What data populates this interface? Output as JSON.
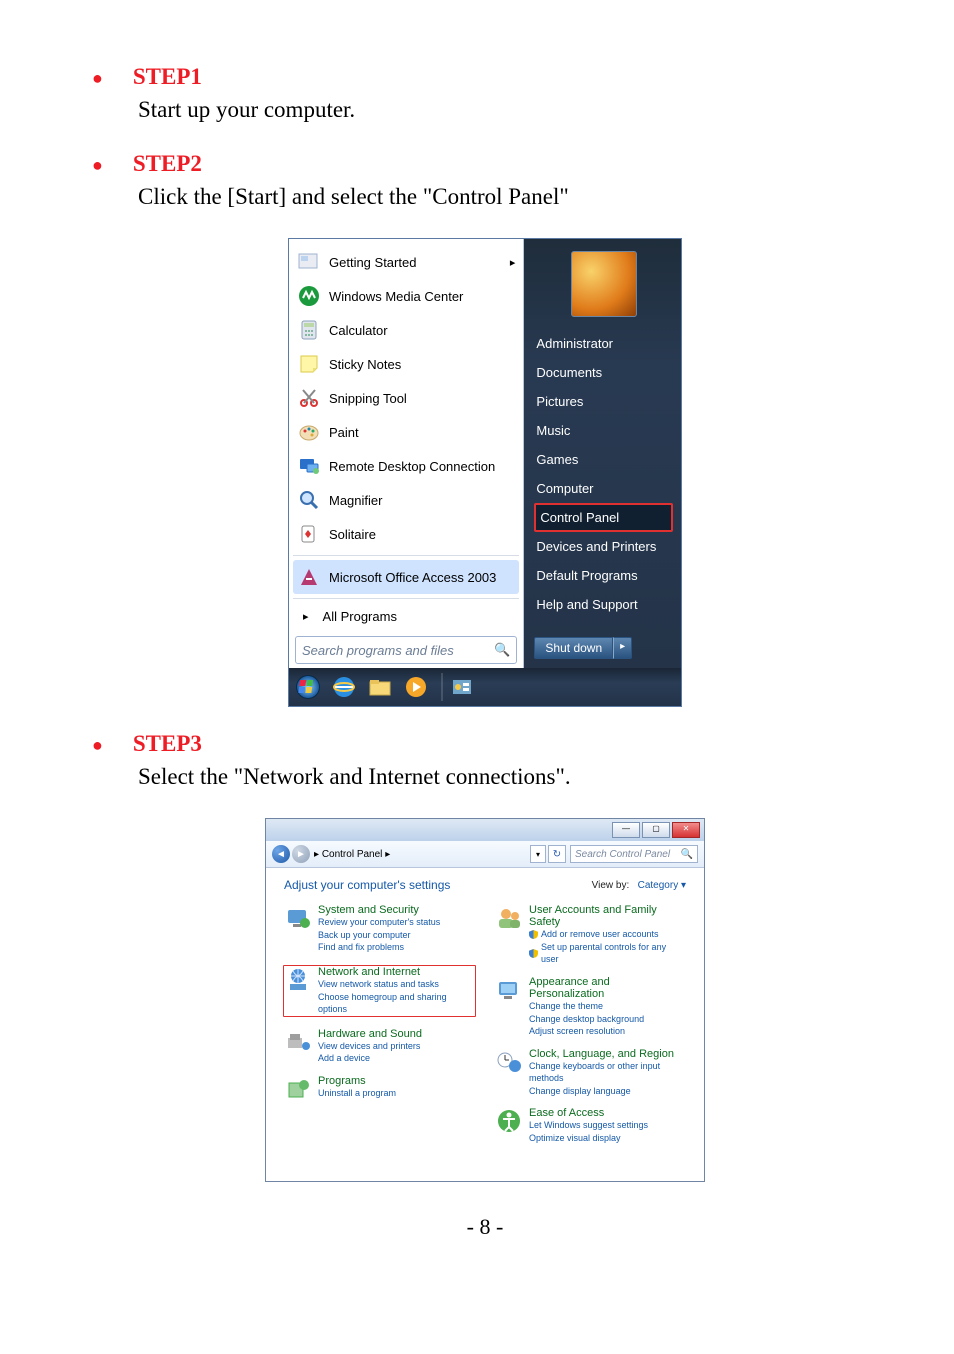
{
  "steps": {
    "s1": {
      "title": "STEP1",
      "desc": "Start up your computer."
    },
    "s2": {
      "title": "STEP2",
      "desc": "Click the [Start] and select the \"Control Panel\""
    },
    "s3": {
      "title": "STEP3",
      "desc": "Select the \"Network and Internet connections\"."
    }
  },
  "startmenu": {
    "left_items": [
      "Getting Started",
      "Windows Media Center",
      "Calculator",
      "Sticky Notes",
      "Snipping Tool",
      "Paint",
      "Remote Desktop Connection",
      "Magnifier",
      "Solitaire",
      "Microsoft Office Access 2003"
    ],
    "all_programs": "All Programs",
    "search_placeholder": "Search programs and files",
    "user_name": "Administrator",
    "right_items": [
      "Documents",
      "Pictures",
      "Music",
      "Games",
      "Computer",
      "Control Panel",
      "Devices and Printers",
      "Default Programs",
      "Help and Support"
    ],
    "shutdown": "Shut down"
  },
  "control_panel": {
    "breadcrumb": "Control Panel",
    "search_placeholder": "Search Control Panel",
    "adjust_heading": "Adjust your computer's settings",
    "view_by_label": "View by:",
    "view_by_value": "Category ▾",
    "left": {
      "sys": {
        "title": "System and Security",
        "l1": "Review your computer's status",
        "l2": "Back up your computer",
        "l3": "Find and fix problems"
      },
      "net": {
        "title": "Network and Internet",
        "l1": "View network status and tasks",
        "l2": "Choose homegroup and sharing options"
      },
      "hw": {
        "title": "Hardware and Sound",
        "l1": "View devices and printers",
        "l2": "Add a device"
      },
      "prog": {
        "title": "Programs",
        "l1": "Uninstall a program"
      }
    },
    "right": {
      "ua": {
        "title": "User Accounts and Family Safety",
        "l1": "Add or remove user accounts",
        "l2": "Set up parental controls for any user"
      },
      "ap": {
        "title": "Appearance and Personalization",
        "l1": "Change the theme",
        "l2": "Change desktop background",
        "l3": "Adjust screen resolution"
      },
      "clr": {
        "title": "Clock, Language, and Region",
        "l1": "Change keyboards or other input methods",
        "l2": "Change display language"
      },
      "ea": {
        "title": "Ease of Access",
        "l1": "Let Windows suggest settings",
        "l2": "Optimize visual display"
      }
    }
  },
  "page_number": "- 8 -"
}
